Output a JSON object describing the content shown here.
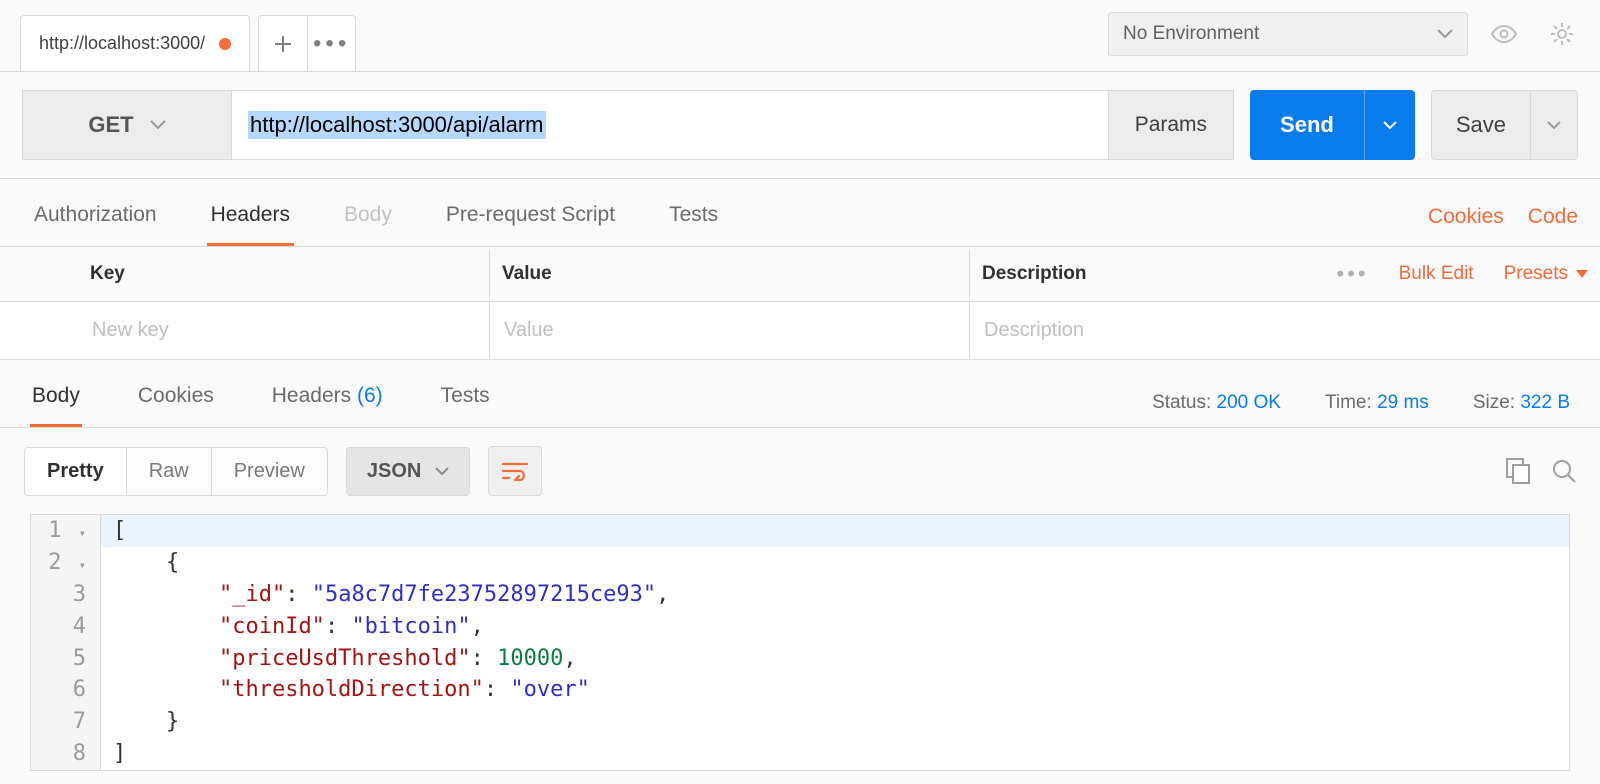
{
  "tab": {
    "title": "http://localhost:3000/"
  },
  "environment": {
    "label": "No Environment"
  },
  "request": {
    "method": "GET",
    "url": "http://localhost:3000/api/alarm",
    "params_label": "Params",
    "send_label": "Send",
    "save_label": "Save"
  },
  "request_tabs": {
    "authorization": "Authorization",
    "headers": "Headers",
    "body": "Body",
    "prerequest": "Pre-request Script",
    "tests": "Tests",
    "cookies_link": "Cookies",
    "code_link": "Code"
  },
  "headers_table": {
    "col_key": "Key",
    "col_value": "Value",
    "col_description": "Description",
    "bulk_edit": "Bulk Edit",
    "presets": "Presets",
    "new_key_placeholder": "New key",
    "value_placeholder": "Value",
    "description_placeholder": "Description"
  },
  "response_tabs": {
    "body": "Body",
    "cookies": "Cookies",
    "headers": "Headers",
    "headers_count": "(6)",
    "tests": "Tests"
  },
  "response_meta": {
    "status_label": "Status:",
    "status_value": "200 OK",
    "time_label": "Time:",
    "time_value": "29 ms",
    "size_label": "Size:",
    "size_value": "322 B"
  },
  "viewer": {
    "pretty": "Pretty",
    "raw": "Raw",
    "preview": "Preview",
    "format": "JSON"
  },
  "response_body": [
    {
      "indent": 0,
      "tokens": [
        {
          "t": "p",
          "v": "["
        }
      ]
    },
    {
      "indent": 1,
      "tokens": [
        {
          "t": "p",
          "v": "{"
        }
      ]
    },
    {
      "indent": 2,
      "tokens": [
        {
          "t": "k",
          "v": "\"_id\""
        },
        {
          "t": "p",
          "v": ": "
        },
        {
          "t": "s",
          "v": "\"5a8c7d7fe23752897215ce93\""
        },
        {
          "t": "p",
          "v": ","
        }
      ]
    },
    {
      "indent": 2,
      "tokens": [
        {
          "t": "k",
          "v": "\"coinId\""
        },
        {
          "t": "p",
          "v": ": "
        },
        {
          "t": "s",
          "v": "\"bitcoin\""
        },
        {
          "t": "p",
          "v": ","
        }
      ]
    },
    {
      "indent": 2,
      "tokens": [
        {
          "t": "k",
          "v": "\"priceUsdThreshold\""
        },
        {
          "t": "p",
          "v": ": "
        },
        {
          "t": "n",
          "v": "10000"
        },
        {
          "t": "p",
          "v": ","
        }
      ]
    },
    {
      "indent": 2,
      "tokens": [
        {
          "t": "k",
          "v": "\"thresholdDirection\""
        },
        {
          "t": "p",
          "v": ": "
        },
        {
          "t": "s",
          "v": "\"over\""
        }
      ]
    },
    {
      "indent": 1,
      "tokens": [
        {
          "t": "p",
          "v": "}"
        }
      ]
    },
    {
      "indent": 0,
      "tokens": [
        {
          "t": "p",
          "v": "]"
        }
      ]
    }
  ]
}
